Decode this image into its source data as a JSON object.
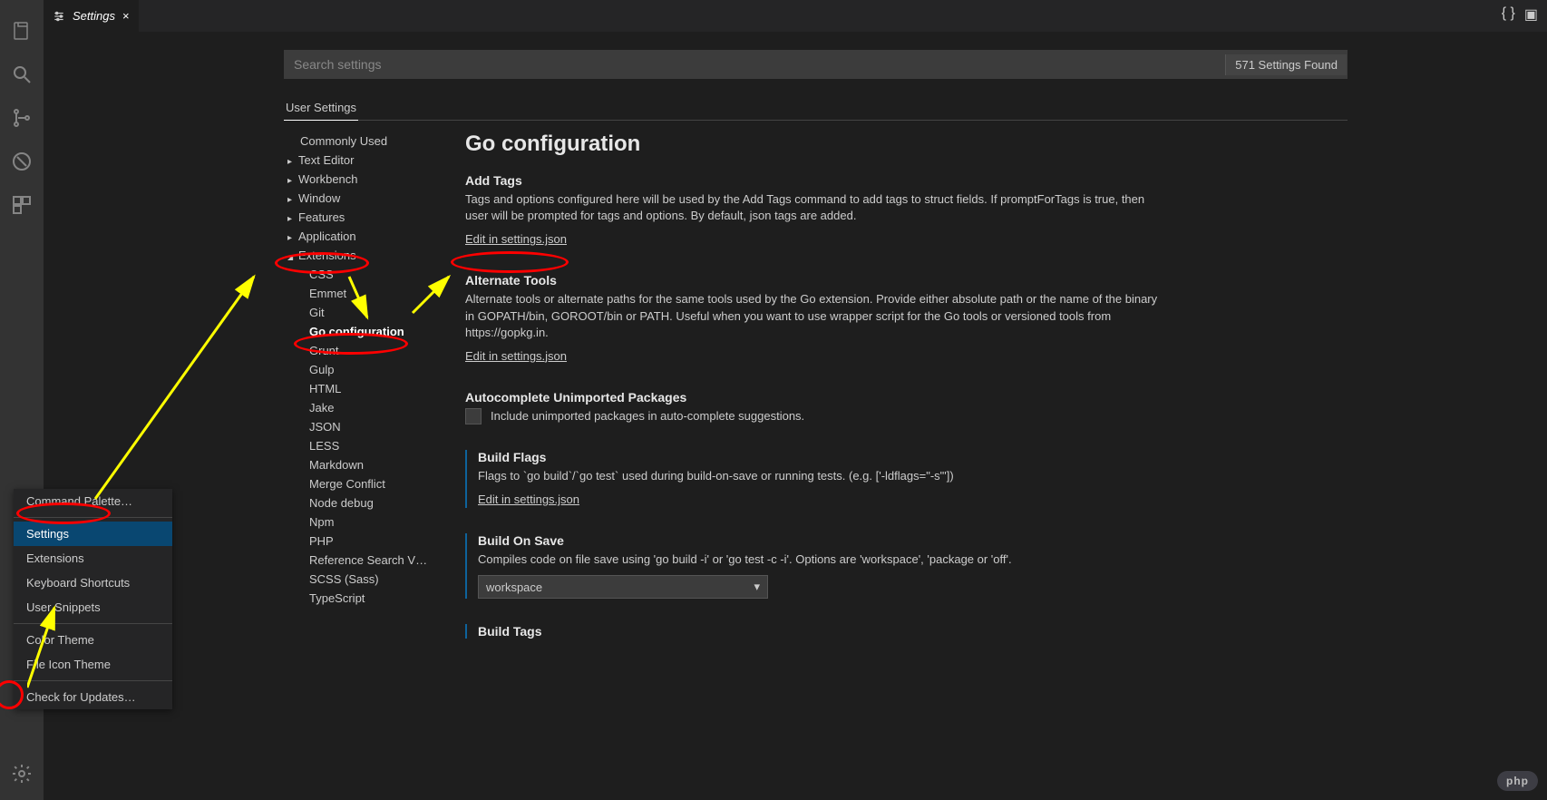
{
  "tab": {
    "title": "Settings",
    "close": "×"
  },
  "topIcons": {
    "braces": "{ }",
    "split": "▣"
  },
  "search": {
    "placeholder": "Search settings",
    "found": "571 Settings Found"
  },
  "scope": {
    "user": "User Settings"
  },
  "toc": {
    "commonly": "Commonly Used",
    "textEditor": "Text Editor",
    "workbench": "Workbench",
    "window": "Window",
    "features": "Features",
    "application": "Application",
    "extensions": "Extensions",
    "ext": {
      "css": "CSS",
      "emmet": "Emmet",
      "git": "Git",
      "go": "Go configuration",
      "grunt": "Grunt",
      "gulp": "Gulp",
      "html": "HTML",
      "jake": "Jake",
      "json": "JSON",
      "less": "LESS",
      "markdown": "Markdown",
      "merge": "Merge Conflict",
      "node": "Node debug",
      "npm": "Npm",
      "php": "PHP",
      "refsearch": "Reference Search V…",
      "scss": "SCSS (Sass)",
      "ts": "TypeScript"
    }
  },
  "content": {
    "heading": "Go configuration",
    "addTags": {
      "label": "Add Tags",
      "desc": "Tags and options configured here will be used by the Add Tags command to add tags to struct fields. If promptForTags is true, then user will be prompted for tags and options. By default, json tags are added.",
      "link": "Edit in settings.json"
    },
    "alternateTools": {
      "label": "Alternate Tools",
      "desc": "Alternate tools or alternate paths for the same tools used by the Go extension. Provide either absolute path or the name of the binary in GOPATH/bin, GOROOT/bin or PATH. Useful when you want to use wrapper script for the Go tools or versioned tools from https://gopkg.in.",
      "link": "Edit in settings.json"
    },
    "autocomplete": {
      "label": "Autocomplete Unimported Packages",
      "desc": "Include unimported packages in auto-complete suggestions."
    },
    "buildFlags": {
      "label": "Build Flags",
      "desc": "Flags to `go build`/`go test` used during build-on-save or running tests. (e.g. ['-ldflags=\"-s\"'])",
      "link": "Edit in settings.json"
    },
    "buildOnSave": {
      "label": "Build On Save",
      "desc": "Compiles code on file save using 'go build -i' or 'go test -c -i'. Options are 'workspace', 'package or 'off'.",
      "value": "workspace"
    },
    "buildTags": {
      "label": "Build Tags"
    }
  },
  "menu": {
    "cmdPalette": "Command Palette…",
    "settings": "Settings",
    "extensions": "Extensions",
    "keyboard": "Keyboard Shortcuts",
    "snippets": "User Snippets",
    "colorTheme": "Color Theme",
    "iconTheme": "File Icon Theme",
    "updates": "Check for Updates…"
  },
  "watermark": "php"
}
